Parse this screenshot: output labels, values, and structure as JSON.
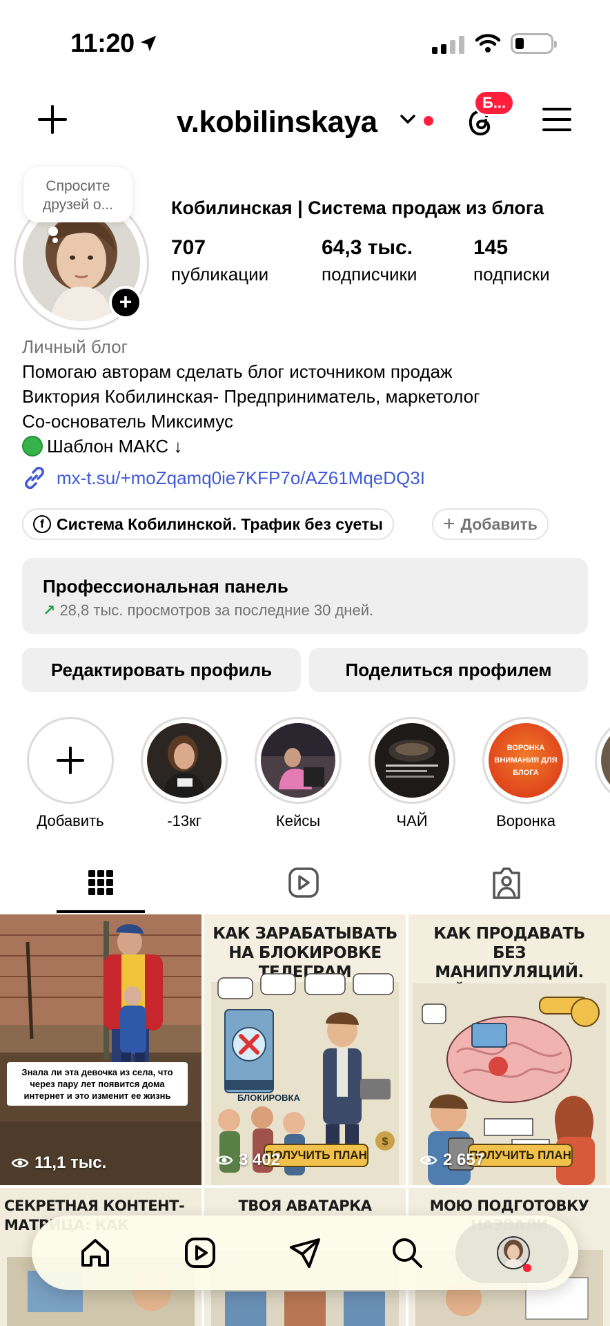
{
  "status_bar": {
    "time": "11:20"
  },
  "header": {
    "username": "v.kobilinskaya",
    "threads_badge": "Б..."
  },
  "profile": {
    "note": "Спросите друзей о...",
    "name": "Кобилинская | Система продаж из блога",
    "stats": [
      {
        "value": "707",
        "label": "публикации"
      },
      {
        "value": "64,3 тыс.",
        "label": "подписчики"
      },
      {
        "value": "145",
        "label": "подписки"
      }
    ],
    "category": "Личный блог",
    "bio_lines": [
      "Помогаю авторам сделать блог источником продаж",
      "Виктория Кобилинская- Предприниматель, маркетолог",
      "Со-основатель Миксимус",
      "Шаблон МАКС ↓"
    ],
    "link": "mx-t.su/+moZqamq0ie7KFP7o/AZ61MqeDQ3I",
    "fb_chip": "Система Кобилинской. Трафик без суеты",
    "add_chip": "Добавить"
  },
  "pro_panel": {
    "title": "Профессиональная панель",
    "subtitle": "28,8 тыс. просмотров за последние 30 дней."
  },
  "buttons": {
    "edit": "Редактировать профиль",
    "share": "Поделиться профилем"
  },
  "highlights": [
    {
      "label": "Добавить"
    },
    {
      "label": "-13кг"
    },
    {
      "label": "Кейсы"
    },
    {
      "label": "ЧАЙ"
    },
    {
      "label": "Воронка",
      "cover_text": "ВОРОНКА ВНИМАНИЯ ДЛЯ БЛОГА"
    }
  ],
  "posts": [
    {
      "caption": "Знала ли эта девочка из села, что через пару лет появится дома интернет и это изменит ее жизнь",
      "views": "11,1 тыс."
    },
    {
      "title": "КАК ЗАРАБАТЫВАТЬ НА БЛОКИРОВКЕ ТЕЛЕГРАМ",
      "views": "3 402",
      "button": "ПОЛУЧИТЬ ПЛАН",
      "art_label": "БЛОКИРОВКА"
    },
    {
      "title": "КАК ПРОДАВАТЬ БЕЗ МАНИПУЛЯЦИЙ. НЕЙРОБИОЛОГИЯ",
      "views": "2 657",
      "button": "ПОЛУЧИТЬ ПЛАН"
    },
    {
      "title": "СЕКРЕТНАЯ КОНТЕНТ-МАТРИЦА: КАК"
    },
    {
      "title": "ТВОЯ АВАТАРКА"
    },
    {
      "title": "МОЮ ПОДГОТОВКУ НАЗВАЛИ"
    }
  ],
  "colors": {
    "accent_red": "#ff1f3d",
    "link_blue": "#3e5ad6",
    "panel_bg": "#efefef",
    "nav_bg": "#fdfceb",
    "plan_button": "#f2c14b"
  },
  "icons": {
    "tabs": [
      "grid-icon",
      "reels-icon",
      "tagged-icon"
    ],
    "nav": [
      "home-icon",
      "reels-icon",
      "send-icon",
      "search-icon",
      "profile-avatar"
    ]
  }
}
